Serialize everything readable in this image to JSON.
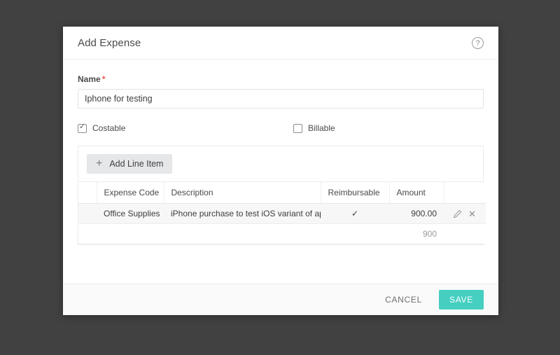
{
  "dialog": {
    "title": "Add Expense",
    "help_icon": "help-circle-icon"
  },
  "form": {
    "name_label": "Name",
    "required_marker": "*",
    "name_value": "Iphone for testing",
    "name_placeholder": "",
    "checkboxes": [
      {
        "label": "Costable",
        "checked": true
      },
      {
        "label": "Billable",
        "checked": false
      }
    ]
  },
  "line_items": {
    "add_button_label": "Add Line Item",
    "add_button_icon": "plus-icon",
    "columns": [
      "",
      "Expense Code",
      "Description",
      "Reimbursable",
      "Amount",
      ""
    ],
    "rows": [
      {
        "handle": "",
        "expense_code": "Office Supplies",
        "description": "iPhone purchase to test iOS variant of app",
        "reimbursable": "✓",
        "amount": "900.00",
        "edit_icon": "pencil-icon",
        "delete_icon": "close-icon"
      }
    ],
    "total_row": {
      "amount": "900"
    }
  },
  "footer": {
    "cancel_label": "CANCEL",
    "save_label": "SAVE"
  },
  "colors": {
    "accent": "#45cfc0",
    "required": "#f5554a",
    "backdrop": "#414141",
    "row_highlight": "#f7f7f7"
  }
}
